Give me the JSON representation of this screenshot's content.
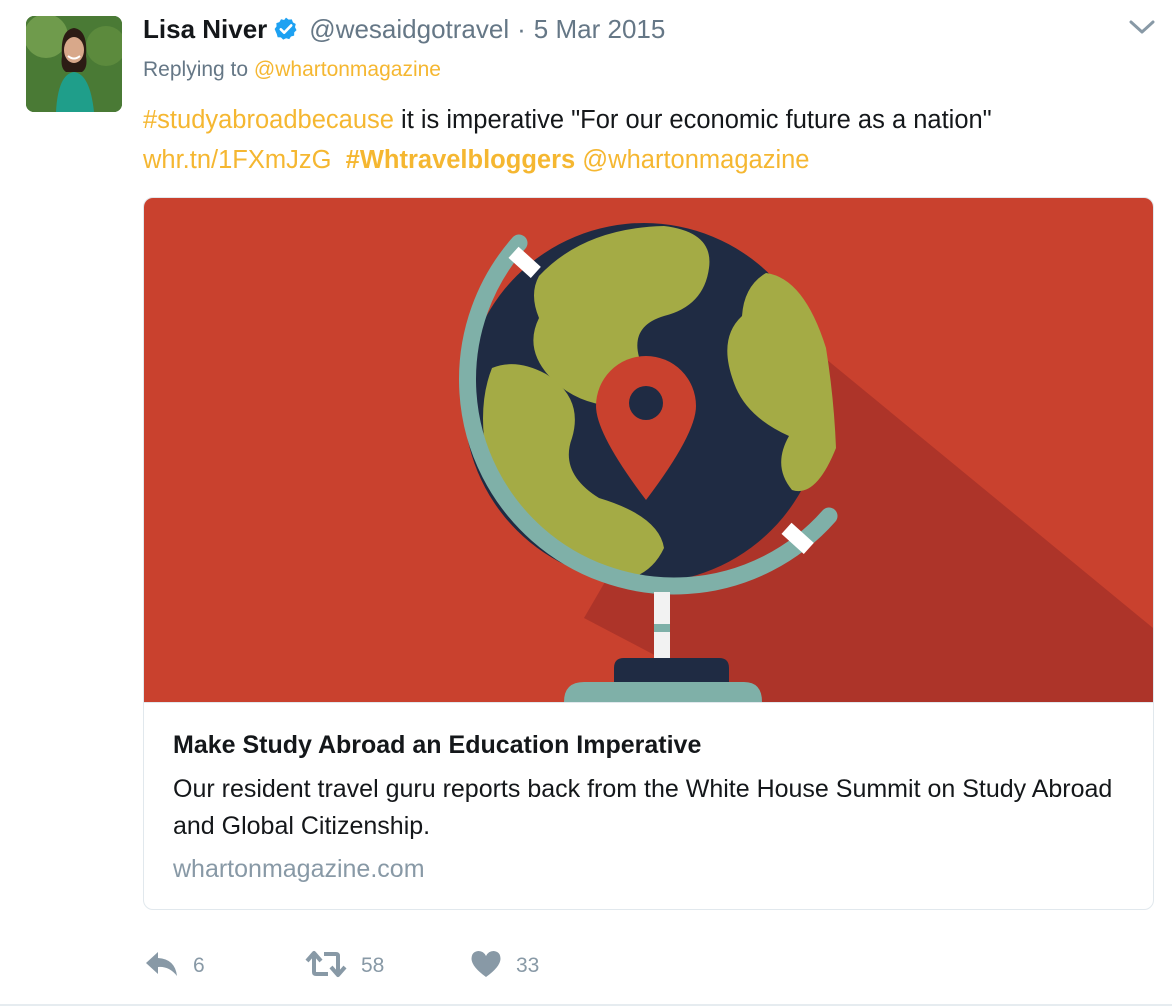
{
  "tweet": {
    "author_name": "Lisa Niver",
    "handle": "@wesaidgotravel",
    "separator": "·",
    "date": "5 Mar 2015",
    "replying_prefix": "Replying to",
    "replying_to": "@whartonmagazine",
    "text": {
      "hashtag1": "#studyabroadbecause",
      "body": " it is imperative \"For our economic future as a nation\"",
      "link": "whr.tn/1FXmJzG",
      "hashtag2": "#Whtravelbloggers",
      "mention": "@whartonmagazine"
    }
  },
  "card": {
    "title": "Make Study Abroad an Education Imperative",
    "description": "Our resident travel guru reports back from the White House Summit on Study Abroad and Global Citizenship.",
    "domain": "whartonmagazine.com"
  },
  "actions": {
    "reply_count": "6",
    "retweet_count": "58",
    "like_count": "33"
  },
  "colors": {
    "link": "#f5b731",
    "verified": "#1da1f2",
    "muted": "#657786",
    "card_background": "#c9412e",
    "globe_ocean": "#1f2b43",
    "globe_land": "#a4ab45",
    "globe_frame": "#7fb0a8"
  },
  "icons": {
    "verified": "verified-badge-icon",
    "caret": "chevron-down-icon",
    "reply": "reply-icon",
    "retweet": "retweet-icon",
    "like": "heart-icon",
    "pin": "map-pin-icon"
  }
}
